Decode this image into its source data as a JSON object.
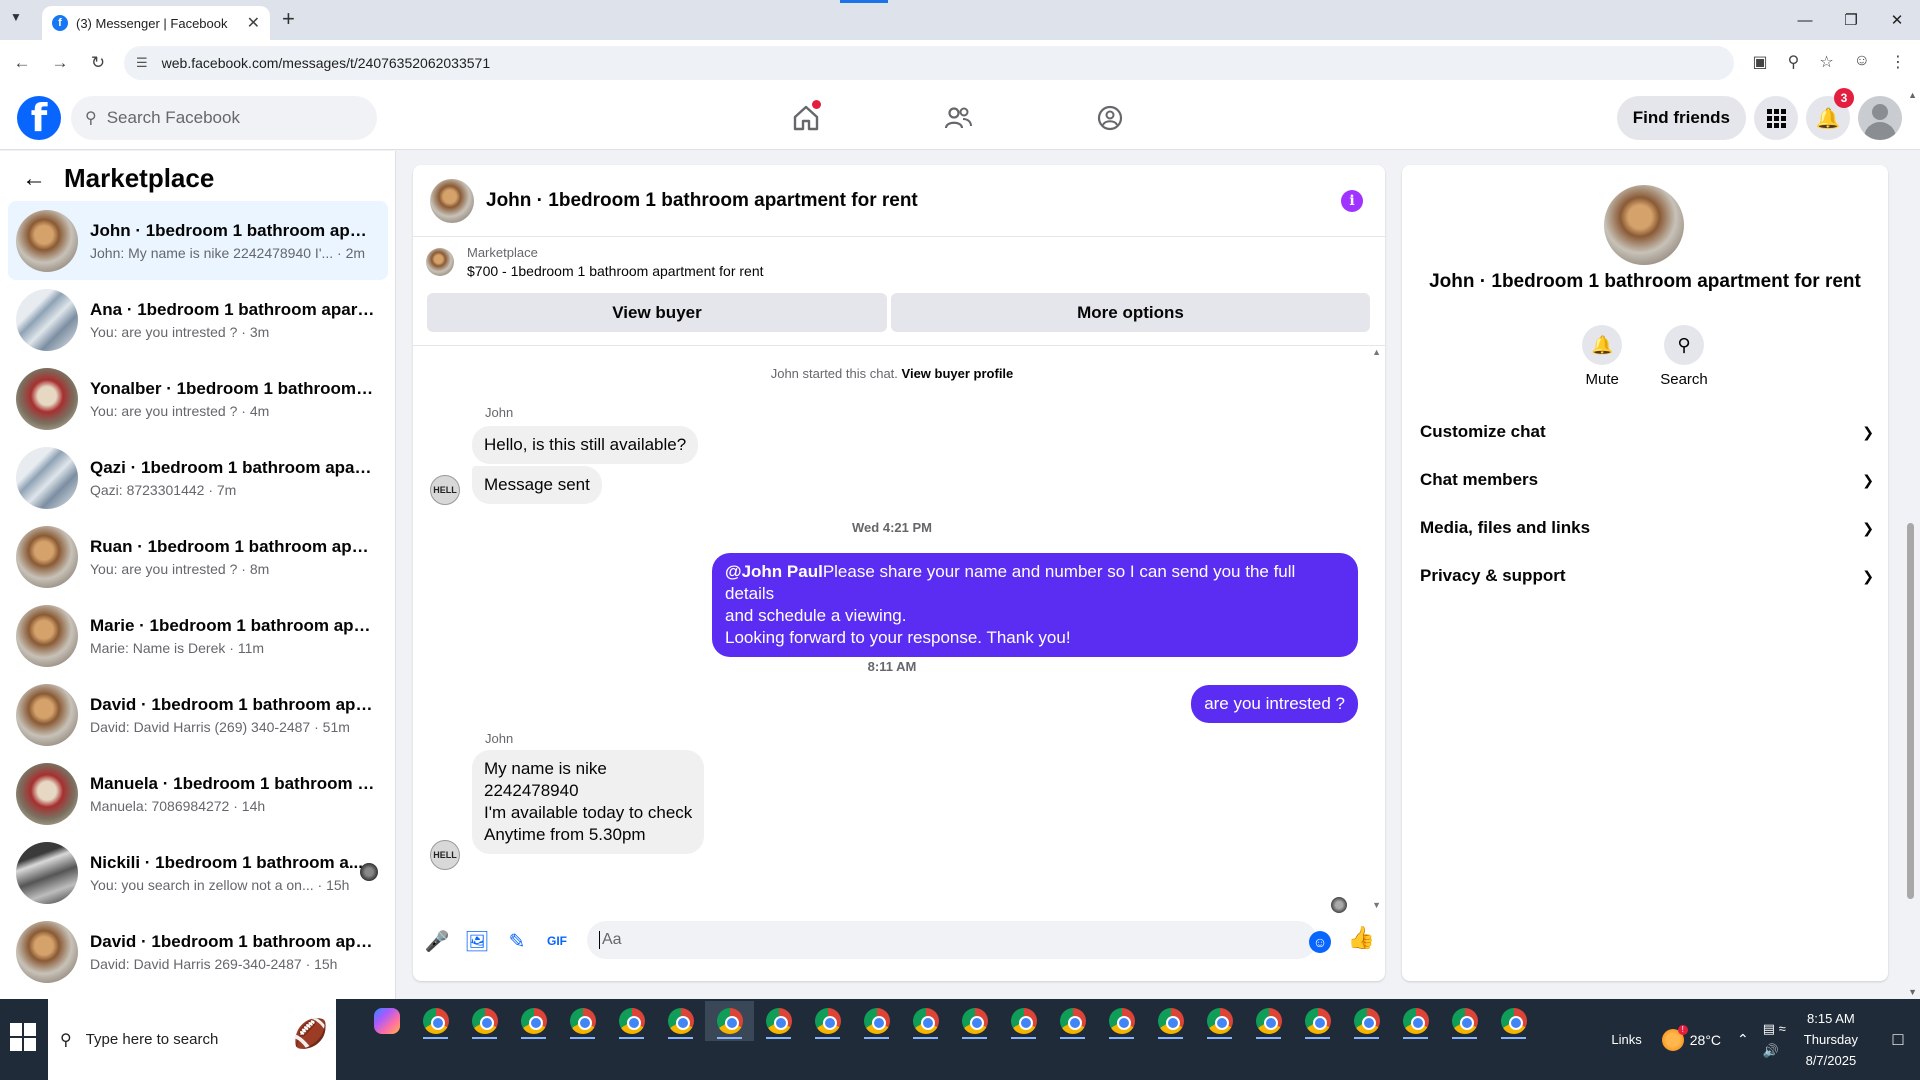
{
  "browser": {
    "tab_title": "(3) Messenger | Facebook",
    "url": "web.facebook.com/messages/t/24076352062033571"
  },
  "fb_header": {
    "search_placeholder": "Search Facebook",
    "find_friends": "Find friends",
    "notification_count": "3"
  },
  "sidebar": {
    "title": "Marketplace",
    "conversations": [
      {
        "name": "John · 1bedroom 1 bathroom apart...",
        "preview": "John: My name is nike 2242478940 I'...",
        "time": "· 2m"
      },
      {
        "name": "Ana · 1bedroom 1 bathroom apart...",
        "preview": "You: are you intrested ?",
        "time": "· 3m"
      },
      {
        "name": "Yonalber · 1bedroom 1 bathroom a...",
        "preview": "You: are you intrested ?",
        "time": "· 4m"
      },
      {
        "name": "Qazi · 1bedroom 1 bathroom apart...",
        "preview": "Qazi: 8723301442",
        "time": "· 7m"
      },
      {
        "name": "Ruan · 1bedroom 1 bathroom apar...",
        "preview": "You: are you intrested ?",
        "time": "· 8m"
      },
      {
        "name": "Marie · 1bedroom 1 bathroom apa...",
        "preview": "Marie: Name is Derek",
        "time": "· 11m"
      },
      {
        "name": "David · 1bedroom 1 bathroom apa...",
        "preview": "David: David Harris (269) 340-2487",
        "time": "· 51m"
      },
      {
        "name": "Manuela · 1bedroom 1 bathroom a...",
        "preview": "Manuela: 7086984272",
        "time": "· 14h"
      },
      {
        "name": "Nickili · 1bedroom 1 bathroom a...",
        "preview": "You: you search in zellow not a on...",
        "time": "· 15h"
      },
      {
        "name": "David · 1bedroom 1 bathroom apa...",
        "preview": "David: David Harris 269-340-2487",
        "time": "· 15h"
      }
    ]
  },
  "chat": {
    "title": "John · 1bedroom 1 bathroom apartment for rent",
    "listing_category": "Marketplace",
    "listing_desc": "$700 - 1bedroom 1 bathroom apartment for rent",
    "view_buyer": "View buyer",
    "more_options": "More options",
    "started_text": "John started this chat.",
    "view_buyer_profile": "View buyer profile",
    "sender_name": "John",
    "msg1": "Hello, is this still available?",
    "msg2": "Message sent",
    "avatar_text": "HELL",
    "time1": "Wed 4:21 PM",
    "out_mention": "@John Paul",
    "out_msg1_line1": "Please share your name and number so I can send you the full details",
    "out_msg1_line2": "and schedule a viewing.",
    "out_msg1_line3": "Looking forward to your response. Thank you!",
    "time2": "8:11 AM",
    "out_msg2": "are you intrested ?",
    "in_msg3_line1": "My name is nike",
    "in_msg3_line2": "2242478940",
    "in_msg3_line3": "I'm available today to check",
    "in_msg3_line4": "Anytime from 5.30pm",
    "composer_placeholder": "Aa"
  },
  "info_panel": {
    "name": "John · 1bedroom 1 bathroom apartment for rent",
    "mute": "Mute",
    "search": "Search",
    "sections": [
      "Customize chat",
      "Chat members",
      "Media, files and links",
      "Privacy & support"
    ]
  },
  "taskbar": {
    "search_placeholder": "Type here to search",
    "links": "Links",
    "temperature": "28°C",
    "time": "8:15 AM",
    "day": "Thursday",
    "date": "8/7/2025"
  },
  "colors": {
    "fb_blue": "#0866ff",
    "outgoing_bubble": "#5b2cf2",
    "incoming_bubble": "#f0f0f0",
    "info_purple": "#a033ff"
  }
}
